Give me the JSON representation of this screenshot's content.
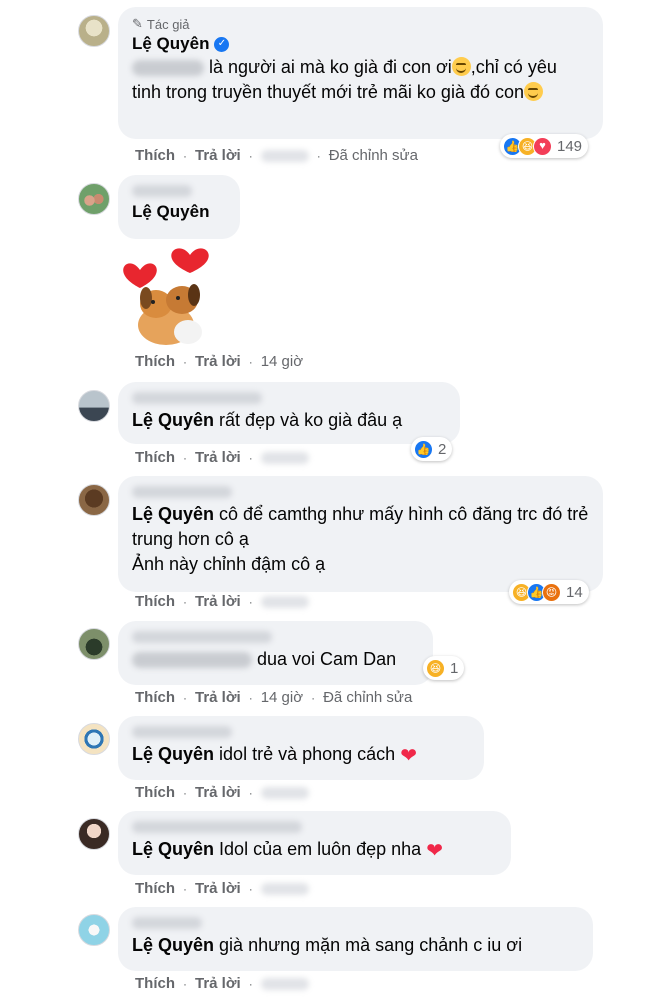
{
  "comments": [
    {
      "author_tag": "Tác giả",
      "author": "Lệ Quyên",
      "text": "là người ai mà ko già đi con ơi",
      "text2": ",chỉ có yêu tinh trong truyền thuyết mới trẻ mãi ko già đó con",
      "like": "Thích",
      "reply": "Trả lời",
      "edited": "Đã chỉnh sửa",
      "reaction_count": "149"
    },
    {
      "mention": "Lệ Quyên",
      "like": "Thích",
      "reply": "Trả lời",
      "time": "14 giờ"
    },
    {
      "mention": "Lệ Quyên",
      "text": "rất đẹp và ko già đâu ạ",
      "like": "Thích",
      "reply": "Trả lời",
      "reaction_count": "2"
    },
    {
      "mention": "Lệ Quyên",
      "text": "cô để camthg như mấy hình cô đăng trc đó trẻ trung hơn cô ạ",
      "text2": "Ảnh này chỉnh đậm cô ạ",
      "like": "Thích",
      "reply": "Trả lời",
      "reaction_count": "14"
    },
    {
      "text": "dua voi Cam Dan",
      "like": "Thích",
      "reply": "Trả lời",
      "time": "14 giờ",
      "edited": "Đã chỉnh sửa",
      "reaction_count": "1"
    },
    {
      "mention": "Lệ Quyên",
      "text": "idol trẻ và phong cách",
      "like": "Thích",
      "reply": "Trả lời"
    },
    {
      "mention": "Lệ Quyên",
      "text": "Idol của em luôn đẹp nha",
      "like": "Thích",
      "reply": "Trả lời"
    },
    {
      "mention": "Lệ Quyên",
      "text": "già nhưng mặn mà sang chảnh c iu ơi",
      "like": "Thích",
      "reply": "Trả lời"
    }
  ],
  "icons": {
    "pencil": "pencil-icon",
    "verified": "verified-badge-icon",
    "like": "like-reaction-icon",
    "haha": "haha-reaction-icon",
    "love": "love-reaction-icon",
    "angry": "angry-reaction-icon",
    "heart": "heart-emoji"
  },
  "colors": {
    "bubble": "#f0f2f5",
    "like_blue": "#1877f2",
    "meta_gray": "#65676b"
  }
}
